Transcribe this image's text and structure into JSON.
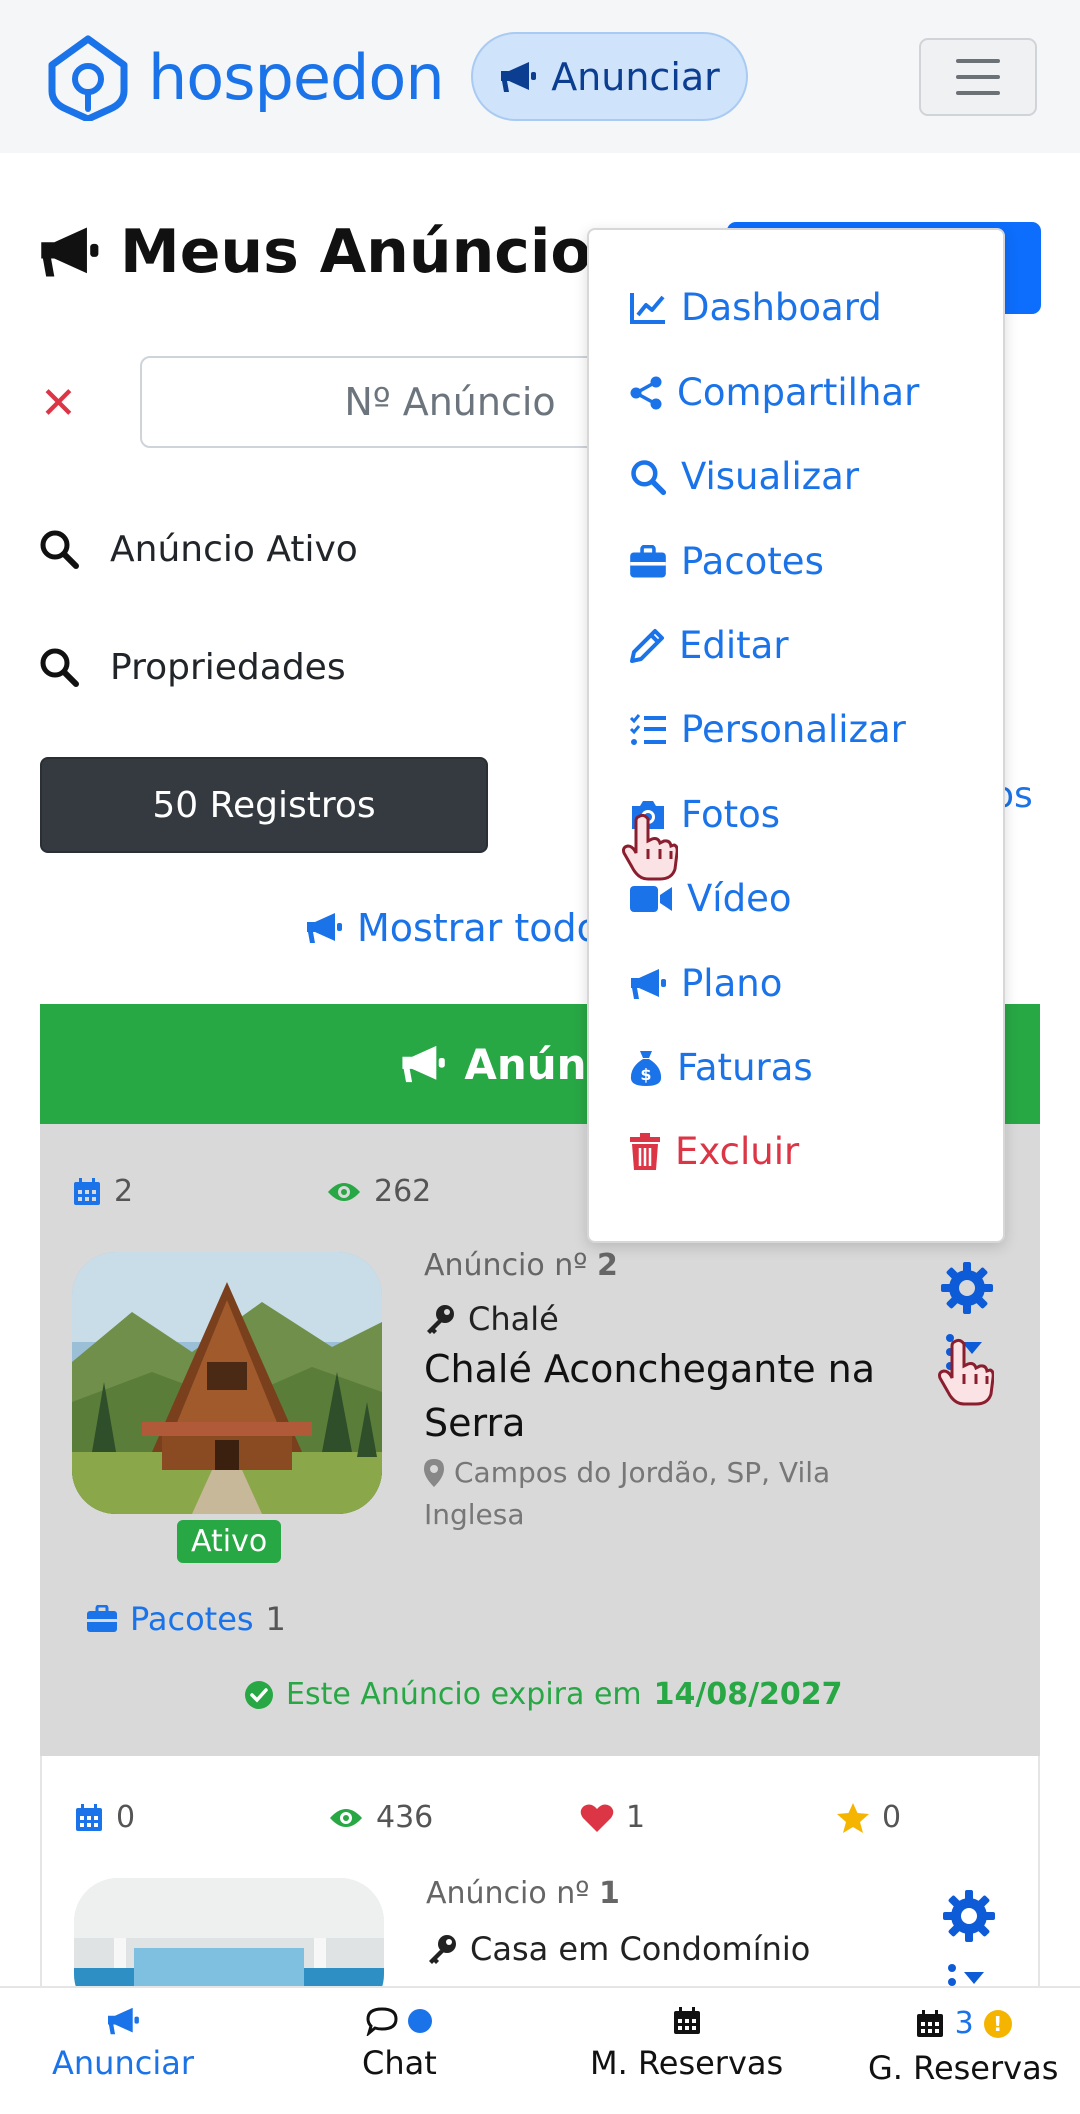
{
  "header": {
    "logo_text": "hospedon",
    "anunciar_button": "Anunciar",
    "brand_color": "#1a73e8"
  },
  "page": {
    "title": "Meus Anúncios",
    "search_placeholder": "Nº Anúncio",
    "filters": [
      "Anúncio Ativo",
      "Propriedades"
    ],
    "registros_button": "50 Registros",
    "partial_right_text": "os",
    "mostrar_todos": "Mostrar todos",
    "section_title": "Anúncios"
  },
  "menu": {
    "items": [
      {
        "label": "Dashboard",
        "icon": "chart-line-icon"
      },
      {
        "label": "Compartilhar",
        "icon": "share-icon"
      },
      {
        "label": "Visualizar",
        "icon": "search-icon"
      },
      {
        "label": "Pacotes",
        "icon": "briefcase-icon"
      },
      {
        "label": "Editar",
        "icon": "pencil-icon"
      },
      {
        "label": "Personalizar",
        "icon": "checklist-icon"
      },
      {
        "label": "Fotos",
        "icon": "camera-icon"
      },
      {
        "label": "Vídeo",
        "icon": "video-icon"
      },
      {
        "label": "Plano",
        "icon": "megaphone-icon"
      },
      {
        "label": "Faturas",
        "icon": "money-bag-icon"
      },
      {
        "label": "Excluir",
        "icon": "trash-icon"
      }
    ]
  },
  "listings": [
    {
      "reservations": "2",
      "views": "262",
      "ad_label": "Anúncio nº",
      "ad_number": "2",
      "type": "Chalé",
      "title_line1": "Chalé Aconchegante na",
      "title_line2": "Serra",
      "location_line1": "Campos do Jordão, SP, Vila",
      "location_line2": "Inglesa",
      "status": "Ativo",
      "pacotes_label": "Pacotes",
      "pacotes_count": "1",
      "expira_prefix": "Este Anúncio expira em",
      "expira_date": "14/08/2027"
    },
    {
      "reservations": "0",
      "views": "436",
      "favorites": "1",
      "rating": "0",
      "ad_label": "Anúncio nº",
      "ad_number": "1",
      "type": "Casa em Condomínio"
    }
  ],
  "bottom_nav": {
    "anunciar": "Anunciar",
    "chat": "Chat",
    "m_reservas": "M. Reservas",
    "g_reservas": "G. Reservas",
    "g_reservas_count": "3",
    "alert_mark": "!"
  }
}
